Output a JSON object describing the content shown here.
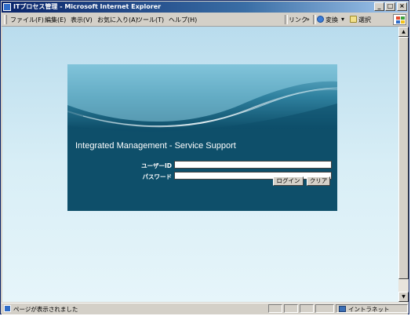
{
  "window": {
    "title": "ITプロセス管理 - Microsoft Internet Explorer",
    "controls": {
      "minimize": "_",
      "maximize": "□",
      "close": "×"
    }
  },
  "menubar": {
    "items": [
      "ファイル(F)",
      "編集(E)",
      "表示(V)",
      "お気に入り(A)",
      "ツール(T)",
      "ヘルプ(H)"
    ],
    "links_label": "リンク",
    "links_chevron": "»",
    "translate_label": "変換",
    "translate_arrow": "▾",
    "select_label": "選択"
  },
  "login": {
    "app_title": "Integrated Management - Service Support",
    "username_label": "ユーザーID",
    "username_value": "",
    "password_label": "パスワード",
    "password_value": "",
    "login_button": "ログイン",
    "clear_button": "クリア"
  },
  "statusbar": {
    "status_text": "ページが表示されました",
    "zone_text": "イントラネット"
  },
  "colors": {
    "panel": "#0e4f6a",
    "title_bar": "#0a246a",
    "page_background": "#d8eef6"
  },
  "icons": [
    "ie-page-icon",
    "translate-icon",
    "select-icon",
    "windows-logo-icon",
    "intranet-icon"
  ]
}
